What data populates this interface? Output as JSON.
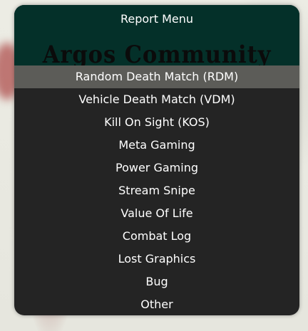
{
  "menu": {
    "title": "Report Menu",
    "logo_text": "Argos Community",
    "selected_index": 0,
    "items": [
      {
        "label": "Random Death Match (RDM)"
      },
      {
        "label": "Vehicle Death Match (VDM)"
      },
      {
        "label": "Kill On Sight (KOS)"
      },
      {
        "label": "Meta Gaming"
      },
      {
        "label": "Power Gaming"
      },
      {
        "label": "Stream Snipe"
      },
      {
        "label": "Value Of Life"
      },
      {
        "label": "Combat Log"
      },
      {
        "label": "Lost Graphics"
      },
      {
        "label": "Bug"
      },
      {
        "label": "Other"
      }
    ]
  },
  "colors": {
    "header_bg": "#043029",
    "menu_bg": "#242424",
    "selected_bg": "#5c5c58",
    "text": "#ffffff"
  }
}
